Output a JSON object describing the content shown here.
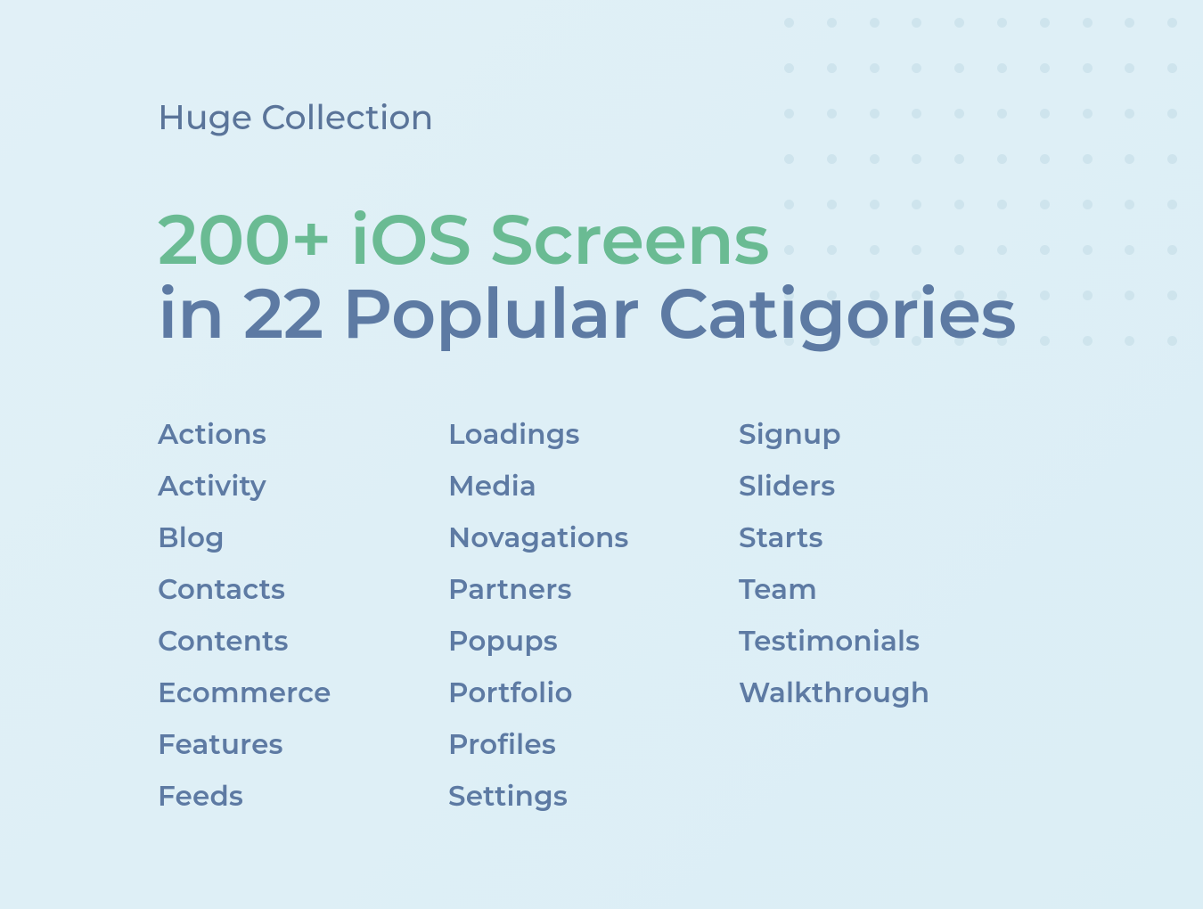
{
  "eyebrow": "Huge Collection",
  "headline": {
    "line1": "200+ iOS Screens",
    "line2": "in 22 Poplular Catigories"
  },
  "categories": {
    "col1": [
      "Actions",
      "Activity",
      "Blog",
      "Contacts",
      "Contents",
      "Ecommerce",
      "Features",
      "Feeds"
    ],
    "col2": [
      "Loadings",
      "Media",
      "Novagations",
      "Partners",
      "Popups",
      "Portfolio",
      "Profiles",
      "Settings"
    ],
    "col3": [
      "Signup",
      "Sliders",
      "Starts",
      "Team",
      "Testimonials",
      "Walkthrough"
    ]
  }
}
